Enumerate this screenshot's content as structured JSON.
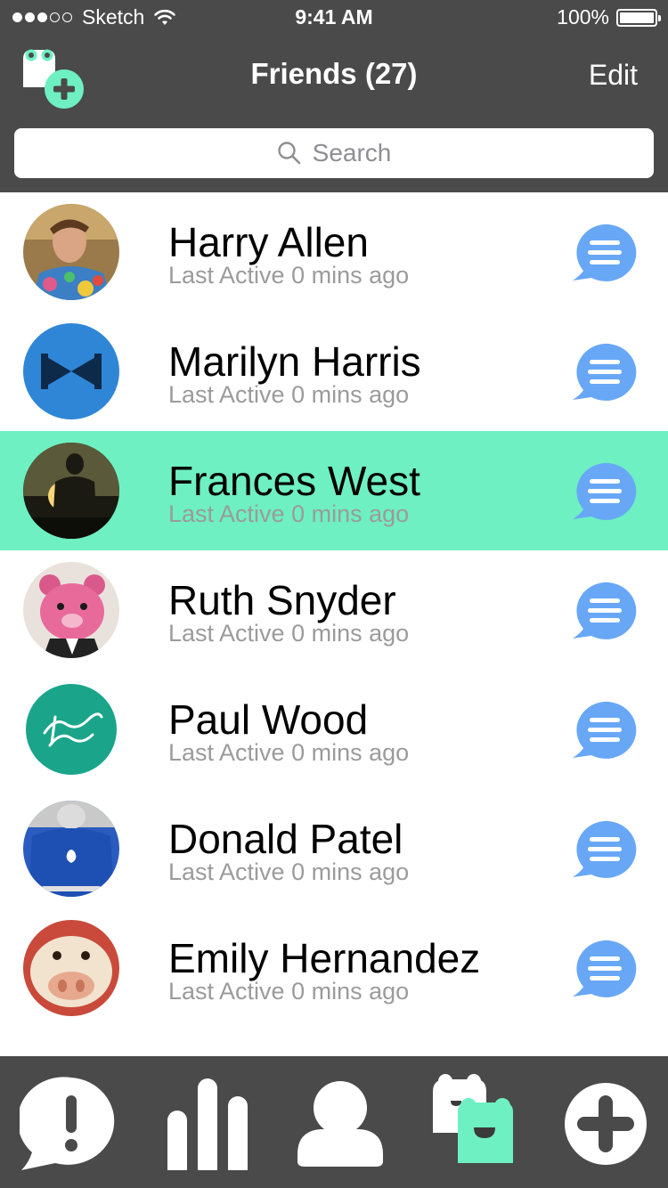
{
  "status_bar": {
    "carrier": "Sketch",
    "time": "9:41 AM",
    "battery": "100%",
    "signal_bars_filled": 3,
    "signal_bars_total": 5
  },
  "nav": {
    "title": "Friends (27)",
    "edit_label": "Edit",
    "add_friend_icon": "add-friend-icon"
  },
  "search": {
    "placeholder": "Search"
  },
  "friends": [
    {
      "name": "Harry Allen",
      "status": "Last Active 0 mins ago",
      "highlighted": false
    },
    {
      "name": "Marilyn Harris",
      "status": "Last Active 0 mins ago",
      "highlighted": false
    },
    {
      "name": "Frances West",
      "status": "Last Active 0 mins ago",
      "highlighted": true
    },
    {
      "name": "Ruth Snyder",
      "status": "Last Active 0 mins ago",
      "highlighted": false
    },
    {
      "name": "Paul Wood",
      "status": "Last Active 0 mins ago",
      "highlighted": false
    },
    {
      "name": "Donald Patel",
      "status": "Last Active 0 mins ago",
      "highlighted": false
    },
    {
      "name": "Emily Hernandez",
      "status": "Last Active 0 mins ago",
      "highlighted": false
    }
  ],
  "tabs": [
    {
      "icon": "alert-bubble-icon",
      "active": false
    },
    {
      "icon": "bar-chart-icon",
      "active": false
    },
    {
      "icon": "profile-icon",
      "active": false
    },
    {
      "icon": "friends-icon",
      "active": true
    },
    {
      "icon": "add-circle-icon",
      "active": false
    }
  ],
  "colors": {
    "bar_bg": "#4a4a4a",
    "accent_green": "#6ef0c2",
    "chat_blue": "#68a7f6",
    "muted_text": "#9b9b9b"
  }
}
